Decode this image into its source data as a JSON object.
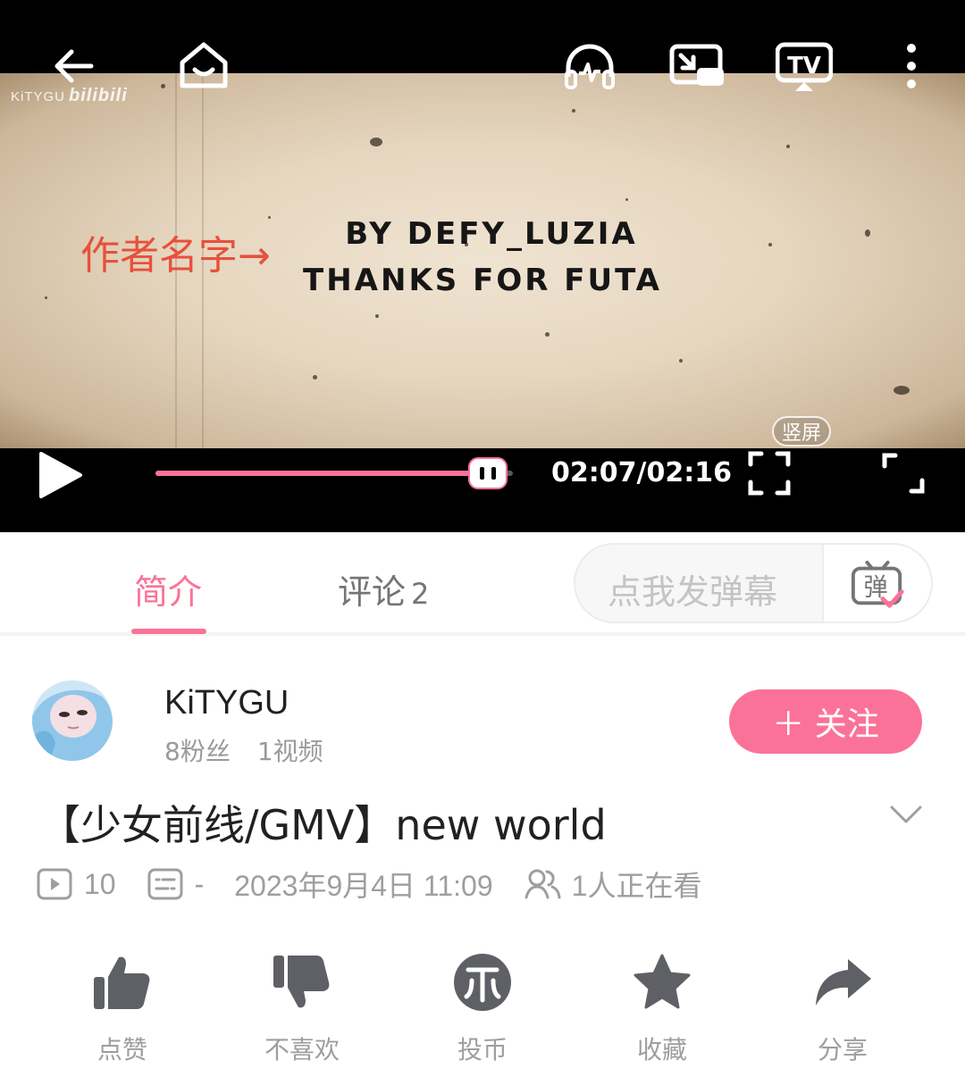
{
  "player": {
    "watermark_user": "KiTYGU",
    "watermark_brand": "bilibili",
    "annotation": "作者名字→",
    "credit_line1": "BY DEFY_LUZIA",
    "credit_line2": "THANKS FOR FUTA",
    "vertical_label": "竖屏",
    "time": "02:07/02:16",
    "progress": 0.93,
    "icons": {
      "back": "back-arrow-icon",
      "home": "home-icon",
      "listen": "headphone-icon",
      "pip": "picture-in-picture-icon",
      "cast": "tv-cast-icon",
      "more": "more-vertical-icon",
      "play": "play-icon",
      "fullscreen": "fullscreen-icon",
      "rotate": "rotate-fullscreen-icon"
    },
    "accent": "#fb7299"
  },
  "tabs": {
    "intro": "简介",
    "comments": "评论",
    "comments_count": "2",
    "danmaku_placeholder": "点我发弹幕",
    "danmaku_button": "弹"
  },
  "author": {
    "name": "KiTYGU",
    "fans": "8粉丝",
    "videos": "1视频",
    "follow_label": "＋ 关注"
  },
  "video": {
    "title": "【少女前线/GMV】new world",
    "plays": "10",
    "danmaku_count": "-",
    "publish_time": "2023年9月4日 11:09",
    "watching": "1人正在看"
  },
  "actions": {
    "like": "点赞",
    "dislike": "不喜欢",
    "coin": "投币",
    "favorite": "收藏",
    "share": "分享"
  }
}
